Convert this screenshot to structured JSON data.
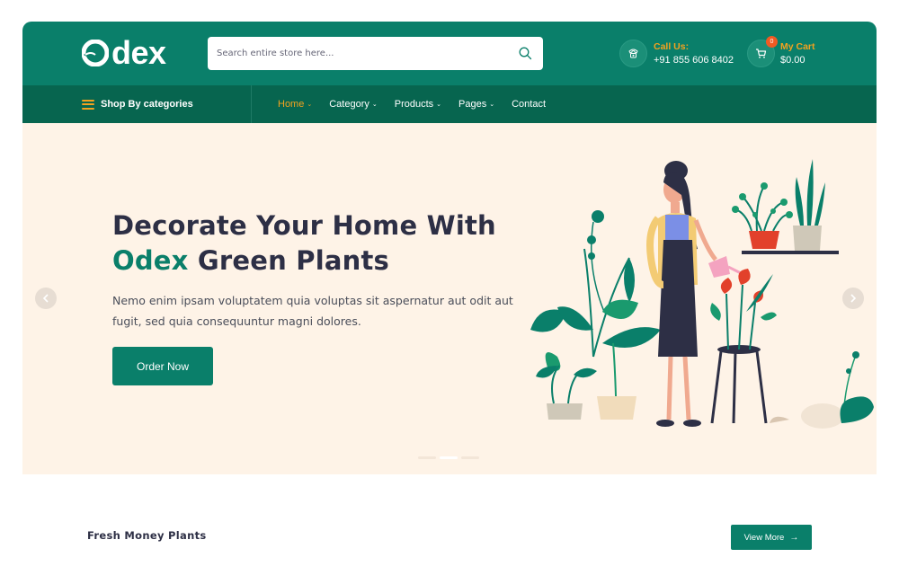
{
  "brand": {
    "logo_text": "dex"
  },
  "search": {
    "placeholder": "Search entire store here..."
  },
  "contact": {
    "label": "Call Us:",
    "phone": "+91 855 606 8402"
  },
  "cart": {
    "label": "My Cart",
    "amount": "$0.00",
    "count": "0"
  },
  "nav": {
    "categories_label": "Shop By categories",
    "items": [
      {
        "label": "Home",
        "dropdown": true,
        "active": true
      },
      {
        "label": "Category",
        "dropdown": true
      },
      {
        "label": "Products",
        "dropdown": true
      },
      {
        "label": "Pages",
        "dropdown": true
      },
      {
        "label": "Contact",
        "dropdown": false
      }
    ]
  },
  "hero": {
    "title_line1": "Decorate Your Home With",
    "title_brand": "Odex",
    "title_line2_rest": " Green Plants",
    "description": "Nemo enim ipsam voluptatem quia voluptas sit aspernatur aut odit aut fugit, sed quia consequuntur magni dolores.",
    "button_label": "Order Now",
    "slide_count": 3,
    "active_slide": 2
  },
  "section": {
    "title": "Fresh Money Plants",
    "view_more_label": "View More"
  },
  "colors": {
    "primary": "#0a7f6a",
    "nav_dark": "#07654f",
    "accent": "#f3a21f",
    "hero_bg": "#fef3e7",
    "heading": "#2d2f45"
  },
  "icons": [
    "logo-mark-icon",
    "search-icon",
    "phone-icon",
    "cart-icon",
    "menu-icon",
    "chevron-down-icon",
    "arrow-left-icon",
    "arrow-right-icon"
  ]
}
